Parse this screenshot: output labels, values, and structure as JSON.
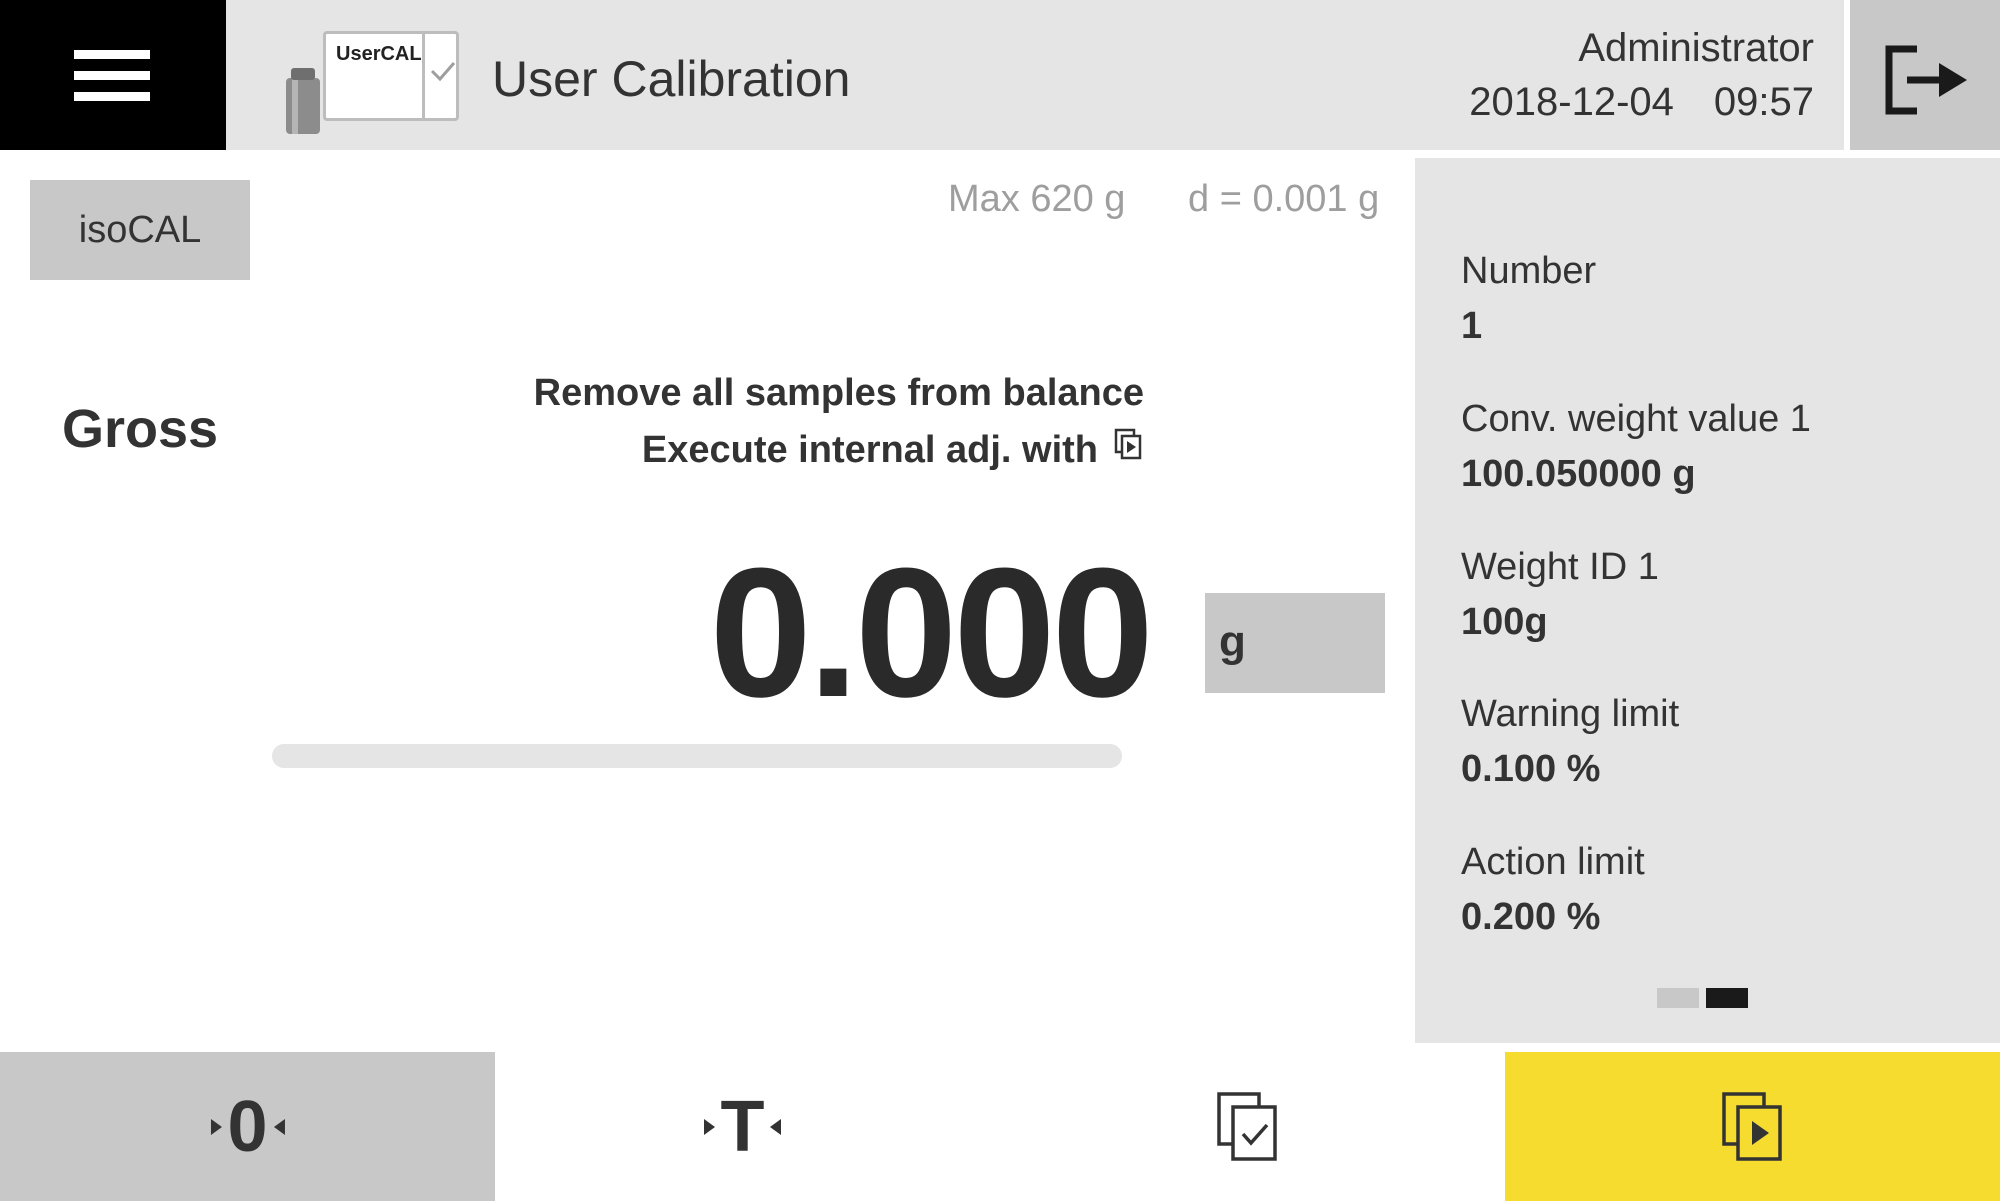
{
  "header": {
    "menu_icon": "hamburger-menu-icon",
    "app_icon": "usercal-weight-icon",
    "app_icon_label": "UserCAL",
    "title": "User Calibration",
    "user": "Administrator",
    "date": "2018-12-04",
    "time": "09:57",
    "logout_icon": "logout-icon"
  },
  "main": {
    "isocal_label": "isoCAL",
    "max_label": "Max 620 g",
    "readability_label": "d = 0.001 g",
    "weight_mode": "Gross",
    "instruction_line1": "Remove all samples from balance",
    "instruction_line2": "Execute internal adj. with",
    "instruction_icon": "start-task-icon",
    "weight_value": "0.000",
    "unit": "g",
    "progress": 0
  },
  "side_panel": {
    "items": [
      {
        "label": "Number",
        "value": "1"
      },
      {
        "label": "Conv. weight value 1",
        "value": "100.050000 g"
      },
      {
        "label": "Weight ID 1",
        "value": "100g"
      },
      {
        "label": "Warning limit",
        "value": "0.100 %"
      },
      {
        "label": "Action limit",
        "value": "0.200 %"
      }
    ],
    "page_count": 2,
    "active_page": 2
  },
  "toolbar": {
    "zero_label": "0",
    "tare_label": "T",
    "verify_icon": "check-document-icon",
    "start_icon": "start-task-icon"
  },
  "colors": {
    "header_bg": "#e5e5e5",
    "menu_bg": "#000000",
    "button_grey": "#c8c8c8",
    "accent_yellow": "#f6dc2e",
    "text": "#333333",
    "muted_text": "#9e9e9e"
  }
}
